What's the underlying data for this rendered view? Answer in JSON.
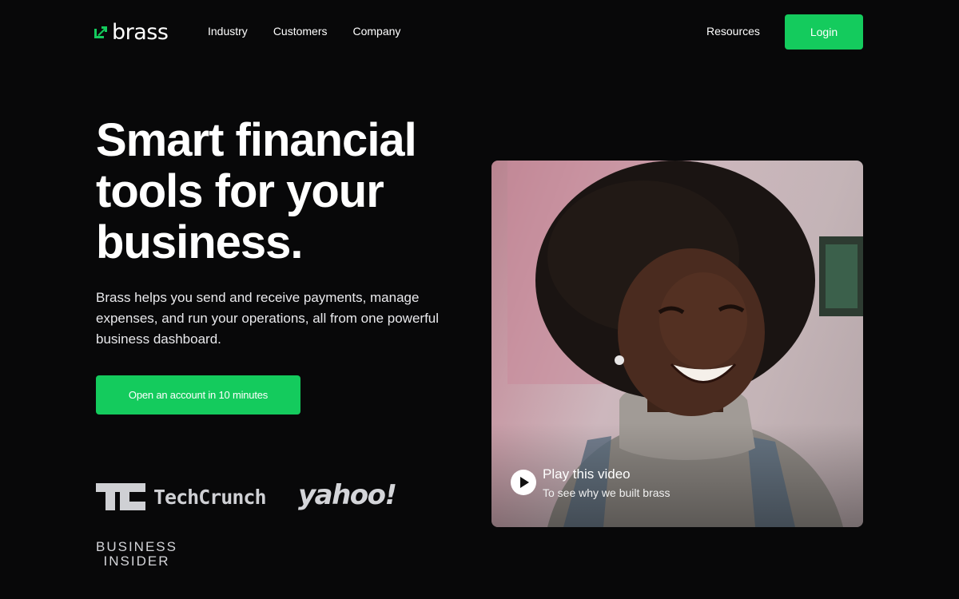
{
  "nav": {
    "brand": "brass",
    "links": [
      "Industry",
      "Customers",
      "Company"
    ],
    "resources": "Resources",
    "login": "Login"
  },
  "hero": {
    "title_lines": [
      "Smart financial",
      "tools for your",
      "business."
    ],
    "subtitle_lines": [
      "Brass helps you send and receive payments, manage",
      "expenses, and run your operations, all from one powerful",
      "business dashboard."
    ],
    "cta": "Open an account in 10 minutes"
  },
  "press": {
    "techcrunch": "TechCrunch",
    "yahoo": "yahoo!",
    "business_insider_lines": [
      "BUSINESS",
      "INSIDER"
    ]
  },
  "video": {
    "title": "Play this video",
    "subtitle": "To see why we built brass"
  },
  "colors": {
    "background": "#080809",
    "accent_green": "#14cb5d",
    "text": "#ffffff"
  }
}
